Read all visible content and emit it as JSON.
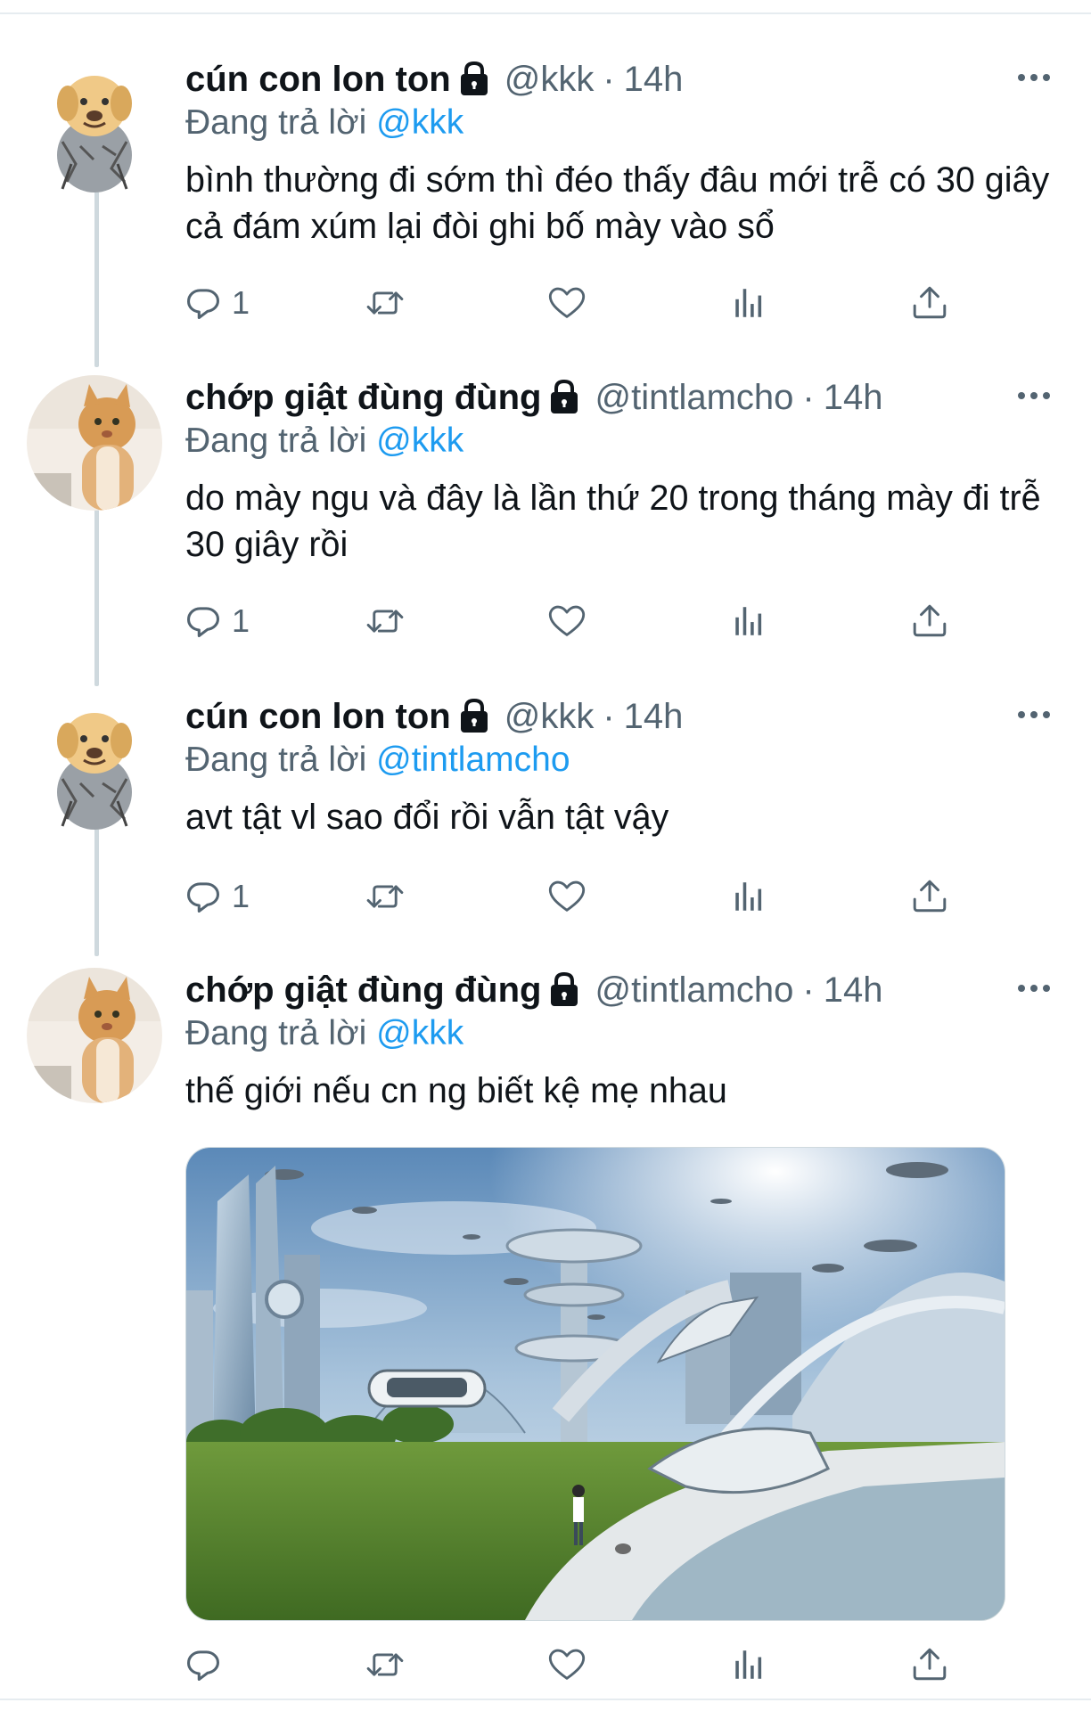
{
  "tweets": [
    {
      "display_name": "cún con lon ton",
      "handle": "@kkk",
      "separator": "·",
      "time": "14h",
      "reply_prefix": "Đang trả lời",
      "reply_to": "@kkk",
      "text": "bình thường đi sớm thì đéo thấy đâu mới trễ có 30 giây cả đám xúm lại đòi ghi bố mày vào sổ",
      "reply_count": "1",
      "avatar": "dog-avatar"
    },
    {
      "display_name": "chớp giật đùng đùng",
      "handle": "@tintlamcho",
      "separator": "·",
      "time": "14h",
      "reply_prefix": "Đang trả lời",
      "reply_to": "@kkk",
      "text": "do mày ngu và đây là lần thứ 20 trong tháng mày đi trễ 30 giây rồi",
      "reply_count": "1",
      "avatar": "cat-avatar"
    },
    {
      "display_name": "cún con lon ton",
      "handle": "@kkk",
      "separator": "·",
      "time": "14h",
      "reply_prefix": "Đang trả lời",
      "reply_to": "@tintlamcho",
      "text": "avt tật vl sao đổi rồi vẫn tật vậy",
      "reply_count": "1",
      "avatar": "dog-avatar"
    },
    {
      "display_name": "chớp giật đùng đùng",
      "handle": "@tintlamcho",
      "separator": "·",
      "time": "14h",
      "reply_prefix": "Đang trả lời",
      "reply_to": "@kkk",
      "text": "thế giới nếu cn ng biết kệ mẹ nhau",
      "reply_count": "",
      "avatar": "cat-avatar",
      "media": "futuristic-city-image"
    }
  ],
  "icons": {
    "reply": "reply-icon",
    "retweet": "retweet-icon",
    "like": "like-icon",
    "analytics": "analytics-icon",
    "share": "share-icon",
    "more": "more-icon",
    "lock": "lock-icon"
  },
  "colors": {
    "text": "#0f1419",
    "secondary": "#536471",
    "link": "#1d9bf0",
    "thread_line": "#cfd9de"
  }
}
